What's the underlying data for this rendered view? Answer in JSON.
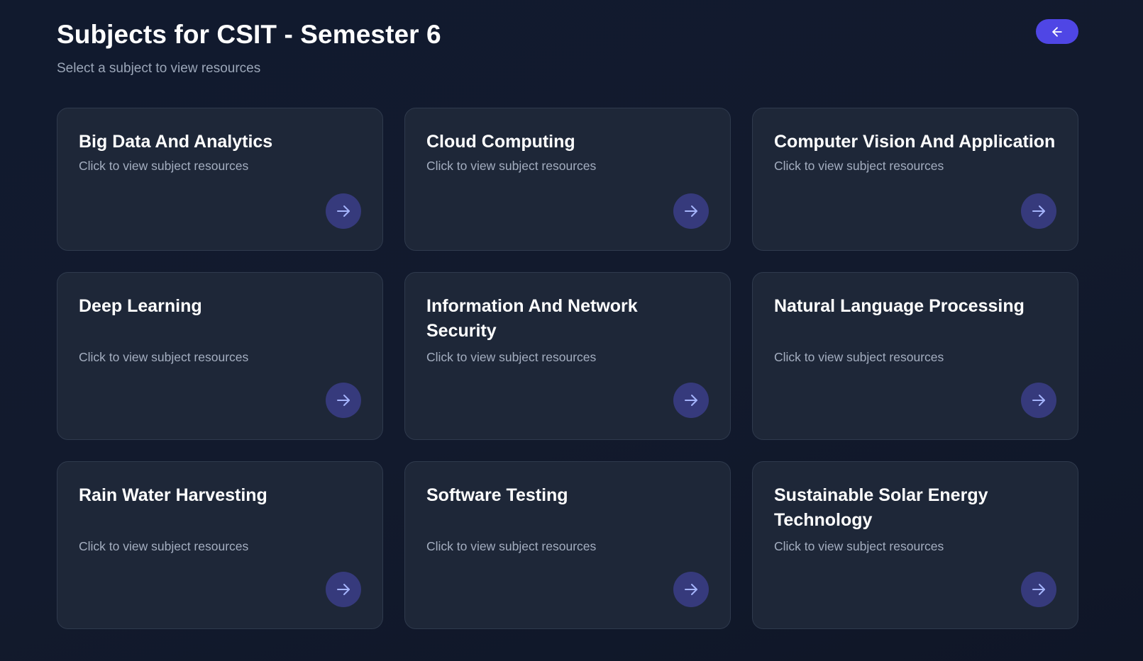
{
  "header": {
    "title": "Subjects for CSIT - Semester 6",
    "subtitle": "Select a subject to view resources",
    "back_icon": "arrow-left-icon"
  },
  "subjects": [
    {
      "title": "Big Data And Analytics",
      "description": "Click to view subject resources",
      "icon": "arrow-right-icon"
    },
    {
      "title": "Cloud Computing",
      "description": "Click to view subject resources",
      "icon": "arrow-right-icon"
    },
    {
      "title": "Computer Vision And Application",
      "description": "Click to view subject resources",
      "icon": "arrow-right-icon"
    },
    {
      "title": "Deep Learning",
      "description": "Click to view subject resources",
      "icon": "arrow-right-icon"
    },
    {
      "title": "Information And Network Security",
      "description": "Click to view subject resources",
      "icon": "arrow-right-icon"
    },
    {
      "title": "Natural Language Processing",
      "description": "Click to view subject resources",
      "icon": "arrow-right-icon"
    },
    {
      "title": "Rain Water Harvesting",
      "description": "Click to view subject resources",
      "icon": "arrow-right-icon"
    },
    {
      "title": "Software Testing",
      "description": "Click to view subject resources",
      "icon": "arrow-right-icon"
    },
    {
      "title": "Sustainable Solar Energy Technology",
      "description": "Click to view subject resources",
      "icon": "arrow-right-icon"
    }
  ],
  "colors": {
    "background": "#121a2d",
    "card": "#1e2738",
    "accent": "#4f46e5",
    "arrow_circle": "#363a7c",
    "arrow_stroke": "#a5b4fc"
  }
}
